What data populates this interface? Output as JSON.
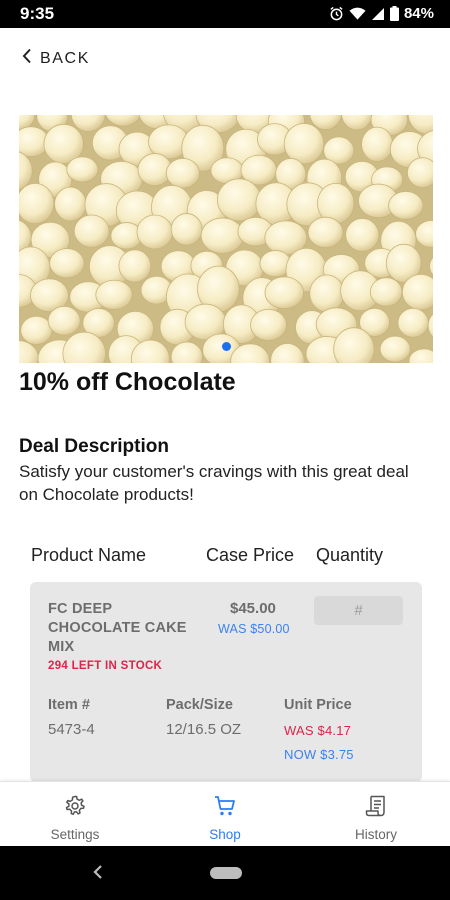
{
  "status_bar": {
    "time": "9:35",
    "battery": "84%"
  },
  "header": {
    "back_label": "BACK"
  },
  "deal": {
    "title": "10% off Chocolate",
    "description_heading": "Deal Description",
    "description": "Satisfy your customer's cravings with this great deal on Chocolate products!"
  },
  "table": {
    "columns": [
      "Product Name",
      "Case Price",
      "Quantity"
    ]
  },
  "product": {
    "name": "FC DEEP CHOCOLATE CAKE MIX",
    "stock": "294 LEFT IN STOCK",
    "price": "$45.00",
    "was_price": "WAS $50.00",
    "quantity_placeholder": "#",
    "item_label": "Item #",
    "item_value": "5473-4",
    "pack_label": "Pack/Size",
    "pack_value": "12/16.5 OZ",
    "unit_label": "Unit Price",
    "unit_was": "WAS $4.17",
    "unit_now": "NOW $3.75"
  },
  "bottom_nav": {
    "items": [
      {
        "label": "Settings",
        "icon": "gear-icon"
      },
      {
        "label": "Shop",
        "icon": "cart-icon",
        "active": true
      },
      {
        "label": "History",
        "icon": "receipt-icon"
      }
    ]
  },
  "colors": {
    "accent_blue": "#2f7cf0",
    "alert_red": "#e0234a",
    "card_bg": "#e7e7e7"
  }
}
